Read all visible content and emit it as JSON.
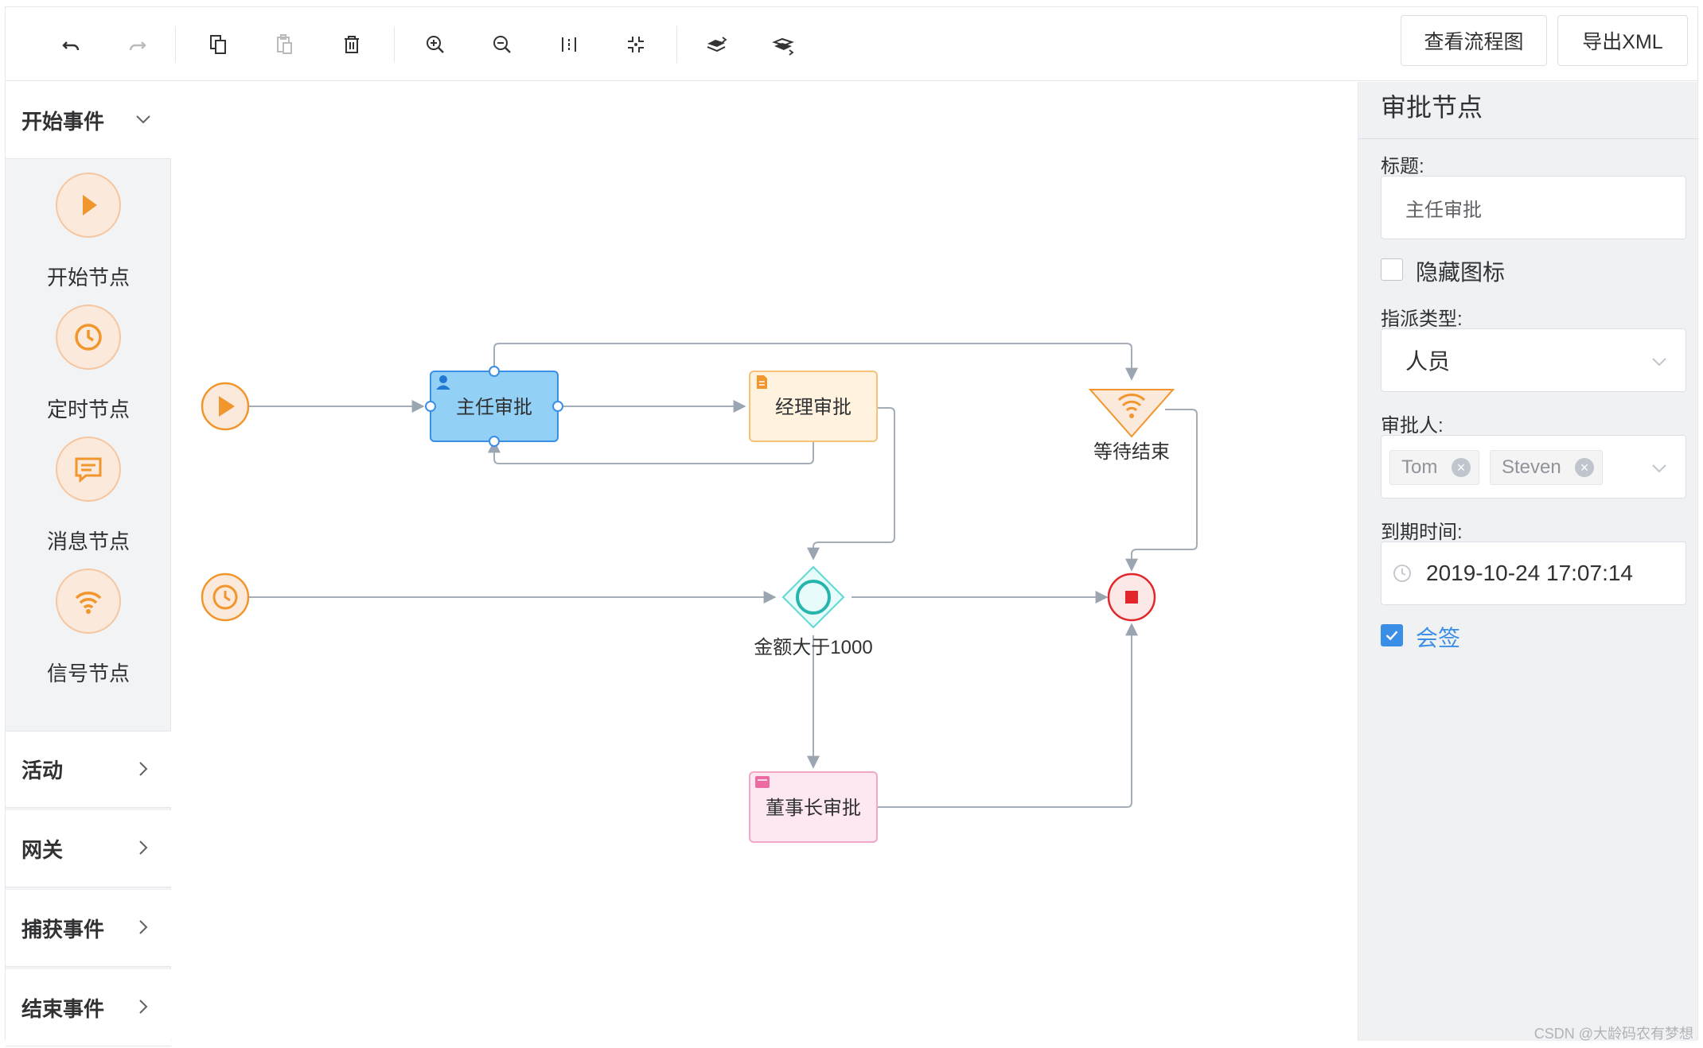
{
  "toolbar": {
    "tools": [
      "undo-icon",
      "redo-icon",
      "copy-icon",
      "paste-icon",
      "delete-icon",
      "zoom-in-icon",
      "zoom-out-icon",
      "fit-view-icon",
      "actual-size-icon",
      "bring-front-icon",
      "send-back-icon"
    ],
    "view_diagram_label": "查看流程图",
    "export_xml_label": "导出XML"
  },
  "palette": {
    "groups": [
      {
        "label": "开始事件",
        "expanded": true
      },
      {
        "label": "活动",
        "expanded": false
      },
      {
        "label": "网关",
        "expanded": false
      },
      {
        "label": "捕获事件",
        "expanded": false
      },
      {
        "label": "结束事件",
        "expanded": false
      }
    ],
    "start_items": [
      {
        "label": "开始节点",
        "icon": "play-icon"
      },
      {
        "label": "定时节点",
        "icon": "clock-icon"
      },
      {
        "label": "消息节点",
        "icon": "message-icon"
      },
      {
        "label": "信号节点",
        "icon": "signal-icon"
      }
    ]
  },
  "diagram": {
    "nodes": {
      "director": "主任审批",
      "manager": "经理审批",
      "wait_end": "等待结束",
      "gateway": "金额大于1000",
      "chairman": "董事长审批"
    }
  },
  "properties": {
    "title": "审批节点",
    "label_title": "标题:",
    "title_value": "主任审批",
    "hide_icon_label": "隐藏图标",
    "hide_icon_checked": false,
    "assign_type_label": "指派类型:",
    "assign_type_value": "人员",
    "approver_label": "审批人:",
    "approvers": [
      "Tom",
      "Steven"
    ],
    "due_label": "到期时间:",
    "due_value": "2019-10-24 17:07:14",
    "countersign_label": "会签",
    "countersign_checked": true
  },
  "colors": {
    "accent": "#3a8ee6",
    "orange": "#f0962c",
    "selected_fill": "#93d0f5",
    "end_red": "#e3262b"
  },
  "watermark": "CSDN @大龄码农有梦想"
}
